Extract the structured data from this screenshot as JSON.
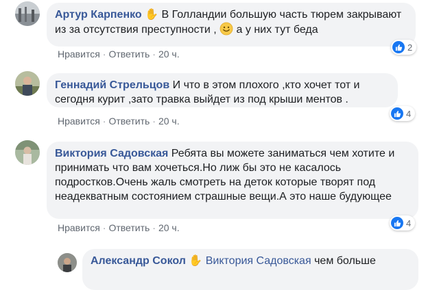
{
  "comments": [
    {
      "author": "Артур Карпенко",
      "text_before_emoji": "В Голландии большую часть тюрем закрывают из за отсутствия преступности ,",
      "emoji": "smiley-emoji",
      "text_after_emoji": "а у них тут беда",
      "actions": {
        "like": "Нравится",
        "reply": "Ответить",
        "time": "20 ч."
      },
      "reaction_count": "2"
    },
    {
      "author": "Геннадий Стрельцов",
      "text": "И что в этом плохого ,кто хочет тот и сегодня курит ,зато травка выйдет из под крыши ментов .",
      "actions": {
        "like": "Нравится",
        "reply": "Ответить",
        "time": "20 ч."
      },
      "reaction_count": "4"
    },
    {
      "author": "Виктория Садовская",
      "text": "Ребята вы можете заниматься чем хотите и принимать что вам хочеться.Но лиж бы это не касалось подростков.Очень жаль смотреть на деток которые творят под неадекватным состоянием страшные вещи.А это наше будующее",
      "actions": {
        "like": "Нравится",
        "reply": "Ответить",
        "time": "20 ч."
      },
      "reaction_count": "4"
    }
  ],
  "reply": {
    "author": "Александр Сокол",
    "mention": "Виктория Садовская",
    "text": "чем больше"
  },
  "colors": {
    "author_link": "#385898",
    "bubble_bg": "#f2f3f5",
    "meta_text": "#606770",
    "like_blue": "#1877f2"
  }
}
